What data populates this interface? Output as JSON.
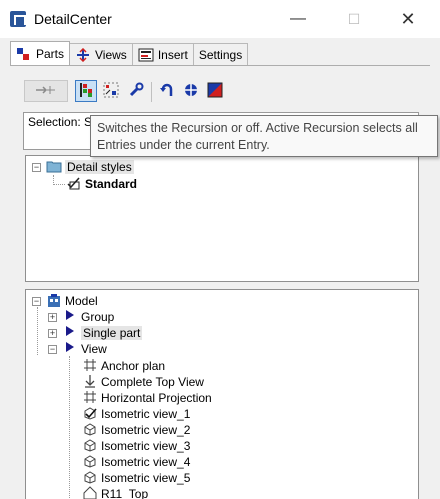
{
  "window": {
    "title": "DetailCenter",
    "minimize_glyph": "—",
    "maximize_glyph": "☐",
    "close_glyph": "✕"
  },
  "tabs": [
    {
      "label": "Parts",
      "icon": "parts-icon",
      "active": true
    },
    {
      "label": "Views",
      "icon": "views-icon",
      "active": false
    },
    {
      "label": "Insert",
      "icon": "insert-icon",
      "active": false
    },
    {
      "label": "Settings",
      "icon": "",
      "active": false
    }
  ],
  "toolbar": {
    "buttons": [
      {
        "icon": "move-icon",
        "state": "disabled"
      },
      {
        "icon": "recursion-icon",
        "state": "pressed"
      },
      {
        "icon": "grid-select-icon",
        "state": "normal"
      },
      {
        "icon": "wrench-icon",
        "state": "normal"
      },
      {
        "icon": "undo-arrow-icon",
        "state": "normal"
      },
      {
        "icon": "flower-icon",
        "state": "normal"
      },
      {
        "icon": "red-blue-icon",
        "state": "normal"
      }
    ]
  },
  "selection": {
    "text": "Selection: Single part ... select ..."
  },
  "tooltip": {
    "line1": "Switches the Recursion or off. Active Recursion selects all",
    "line2": "Entries under the current Entry."
  },
  "styles_tree": {
    "root": "Detail styles",
    "child": "Standard"
  },
  "model_tree": {
    "root": "Model",
    "items": [
      {
        "label": "Group",
        "icon": "arrow-right-icon",
        "expand": "+"
      },
      {
        "label": "Single part",
        "icon": "arrow-right-icon",
        "expand": "+"
      },
      {
        "label": "View",
        "icon": "arrow-right-icon",
        "expand": "−"
      }
    ],
    "views": [
      {
        "label": "Anchor plan",
        "icon": "hash-grid-icon"
      },
      {
        "label": "Complete Top View",
        "icon": "down-arrow-icon"
      },
      {
        "label": "Horizontal Projection",
        "icon": "hash-grid-icon"
      },
      {
        "label": "Isometric view_1",
        "icon": "iso-check-icon"
      },
      {
        "label": "Isometric view_2",
        "icon": "iso-box-icon"
      },
      {
        "label": "Isometric view_3",
        "icon": "iso-box-icon"
      },
      {
        "label": "Isometric view_4",
        "icon": "iso-box-icon"
      },
      {
        "label": "Isometric view_5",
        "icon": "iso-box-icon"
      },
      {
        "label": "R11_Top",
        "icon": "house-icon"
      }
    ]
  },
  "colors": {
    "accent_blue": "#1a3aa8",
    "pressed_bg": "#c9e0f5",
    "selection_gray": "#e5e5e5"
  }
}
